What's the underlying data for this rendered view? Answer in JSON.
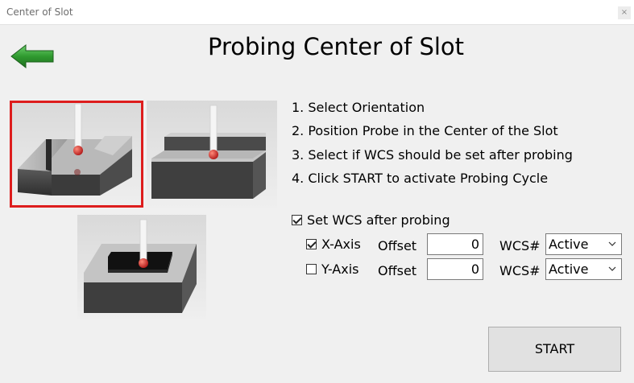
{
  "window": {
    "title": "Center of Slot",
    "close_glyph": "×"
  },
  "heading": "Probing Center of Slot",
  "back_icon": "back-arrow-icon",
  "colors": {
    "accent_green": "#2f9a2f",
    "selection_red": "#dd1d1d",
    "probe_red": "#cc2222"
  },
  "orientations": [
    {
      "name": "slot-vertical",
      "selected": true
    },
    {
      "name": "slot-horizontal",
      "selected": false
    },
    {
      "name": "pocket",
      "selected": false
    }
  ],
  "steps": [
    "1. Select Orientation",
    "2. Position Probe in the Center of the Slot",
    "3. Select if WCS should be set after probing",
    "4. Click START to activate Probing Cycle"
  ],
  "set_wcs": {
    "label": "Set WCS after probing",
    "checked": true
  },
  "axes": [
    {
      "label": "X-Axis",
      "checked": true,
      "offset_label": "Offset",
      "offset_value": "0",
      "wcs_label": "WCS#",
      "wcs_value": "Active"
    },
    {
      "label": "Y-Axis",
      "checked": false,
      "offset_label": "Offset",
      "offset_value": "0",
      "wcs_label": "WCS#",
      "wcs_value": "Active"
    }
  ],
  "start_label": "START"
}
